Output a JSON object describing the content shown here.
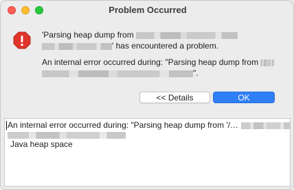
{
  "window": {
    "title": "Problem Occurred"
  },
  "message": {
    "line1_prefix": "'Parsing heap dump from",
    "line2_suffix": "' has encountered a problem.",
    "detail_prefix": "An internal error occurred during: \"Parsing heap dump from",
    "detail_suffix": "\"."
  },
  "buttons": {
    "details_label": "<< Details",
    "ok_label": "OK"
  },
  "details_area": {
    "line1": "An internal error occurred during: \"Parsing heap dump from '/…",
    "line3": "Java heap space"
  },
  "colors": {
    "accent": "#2f7ff7",
    "error_icon": "#e0352b"
  },
  "icons": {
    "error": "error-octagon-icon"
  }
}
